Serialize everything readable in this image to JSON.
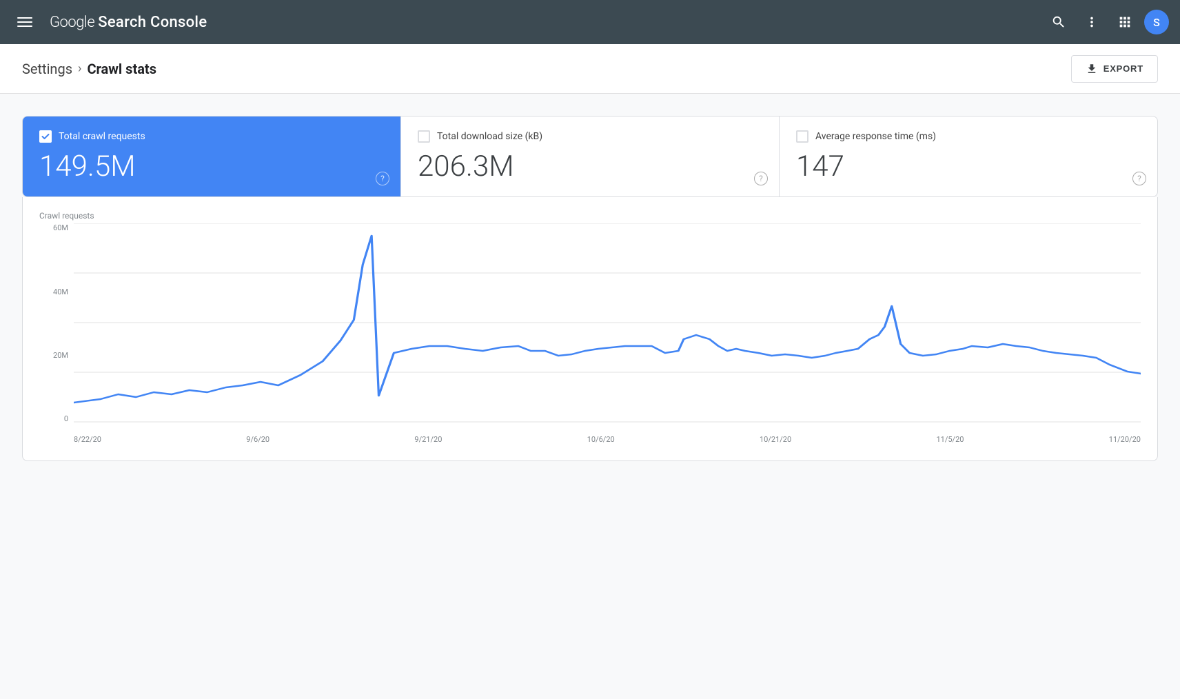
{
  "header": {
    "title_google": "Google",
    "title_rest": "Search Console",
    "avatar_letter": "S",
    "avatar_color": "#4285f4"
  },
  "breadcrumb": {
    "settings_label": "Settings",
    "separator": "›",
    "current_label": "Crawl stats"
  },
  "toolbar": {
    "export_label": "EXPORT"
  },
  "stats": [
    {
      "id": "total_crawl_requests",
      "title": "Total crawl requests",
      "value": "149.5M",
      "active": true
    },
    {
      "id": "total_download_size",
      "title": "Total download size (kB)",
      "value": "206.3M",
      "active": false
    },
    {
      "id": "avg_response_time",
      "title": "Average response time (ms)",
      "value": "147",
      "active": false
    }
  ],
  "chart": {
    "y_axis_label": "Crawl requests",
    "y_labels": [
      "60M",
      "40M",
      "20M",
      "0"
    ],
    "x_labels": [
      "8/22/20",
      "9/6/20",
      "9/21/20",
      "10/6/20",
      "10/21/20",
      "11/5/20",
      "11/20/20"
    ],
    "line_color": "#4285f4",
    "grid_color": "#e0e0e0"
  },
  "icons": {
    "hamburger": "☰",
    "search": "search",
    "more_vert": "more-vert",
    "apps": "apps",
    "export_arrow": "download",
    "help": "?"
  }
}
